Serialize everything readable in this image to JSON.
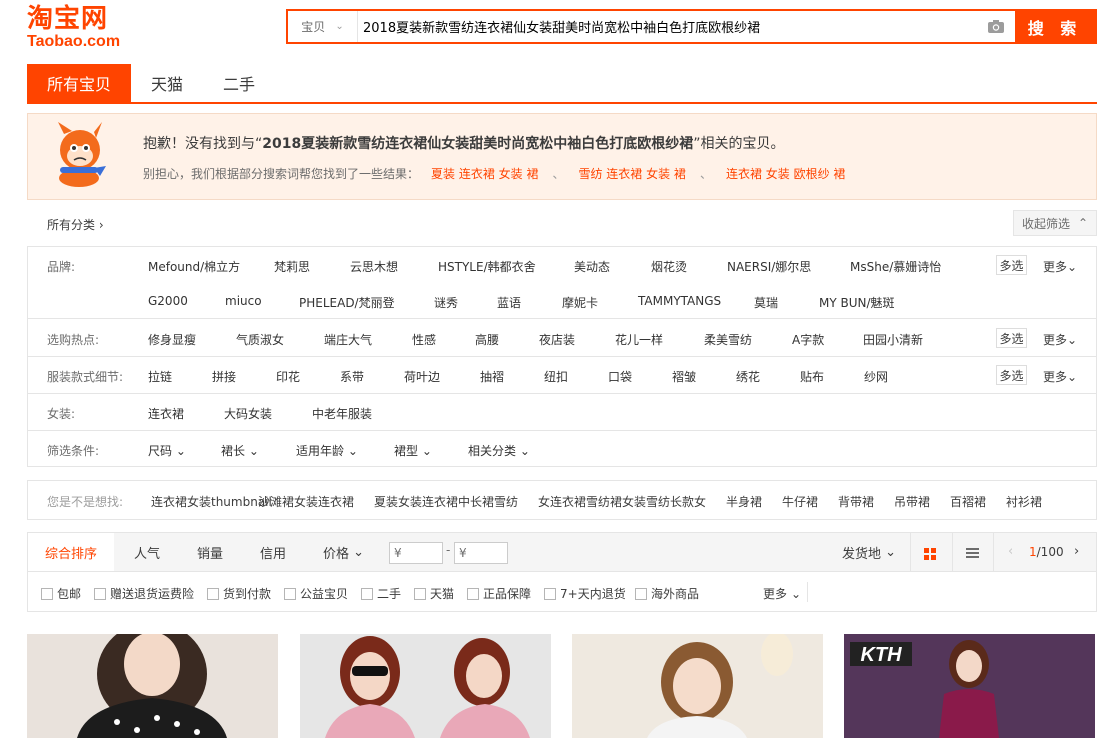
{
  "header": {
    "logo_cn": "淘宝网",
    "logo_en": "Taobao.com",
    "search_category": "宝贝",
    "search_query": "2018夏装新款雪纺连衣裙仙女装甜美时尚宽松中袖白色打底欧根纱裙",
    "search_button": "搜 索"
  },
  "tabs": [
    {
      "label": "所有宝贝",
      "active": true
    },
    {
      "label": "天猫",
      "active": false
    },
    {
      "label": "二手",
      "active": false
    }
  ],
  "notice": {
    "prefix": "抱歉！没有找到与“",
    "query": "2018夏装新款雪纺连衣裙仙女装甜美时尚宽松中袖白色打底欧根纱裙",
    "suffix": "”相关的宝贝。",
    "hint": "别担心，我们根据部分搜索词帮您找到了一些结果：",
    "suggestions": [
      "夏装 连衣裙 女装 裙",
      "雪纺 连衣裙 女装 裙",
      "连衣裙 女装 欧根纱 裙"
    ],
    "separator": "、"
  },
  "filter_header": {
    "all_categories": "所有分类",
    "collapse": "收起筛选"
  },
  "attributes": {
    "brand_label": "品牌:",
    "brands_row1": [
      "Mefound/棉立方",
      "梵莉思",
      "云思木想",
      "HSTYLE/韩都衣舍",
      "美动态",
      "烟花烫",
      "NAERSI/娜尔思",
      "MsShe/慕姗诗怡"
    ],
    "brands_row2": [
      "G2000",
      "miuco",
      "PHELEAD/梵丽登",
      "谜秀",
      "蓝语",
      "摩妮卡",
      "TAMMYTANGS",
      "莫瑞",
      "MY BUN/魅斑"
    ],
    "hot_label": "选购热点:",
    "hot": [
      "修身显瘦",
      "气质淑女",
      "端庄大气",
      "性感",
      "高腰",
      "夜店装",
      "花儿一样",
      "柔美雪纺",
      "A字款",
      "田园小清新"
    ],
    "detail_label": "服装款式细节:",
    "details": [
      "拉链",
      "拼接",
      "印花",
      "系带",
      "荷叶边",
      "抽褶",
      "纽扣",
      "口袋",
      "褶皱",
      "绣花",
      "贴布",
      "纱网"
    ],
    "women_label": "女装:",
    "women": [
      "连衣裙",
      "大码女装",
      "中老年服装"
    ],
    "cond_label": "筛选条件:",
    "conditions": [
      "尺码",
      "裙长",
      "适用年龄",
      "裙型",
      "相关分类"
    ],
    "multi_select": "多选",
    "more": "更多"
  },
  "maybe": {
    "label": "您是不是想找:",
    "keywords": [
      "连衣裙女装thumbnail",
      "沙滩裙女装连衣裙",
      "夏装女装连衣裙中长裙雪纺",
      "女连衣裙雪纺裙女装雪纺长款女",
      "半身裙",
      "牛仔裙",
      "背带裙",
      "吊带裙",
      "百褶裙",
      "衬衫裙"
    ]
  },
  "sortbar": {
    "items": [
      "综合排序",
      "人气",
      "销量",
      "信用",
      "价格"
    ],
    "price_from": "¥",
    "price_to": "¥",
    "dash": "-",
    "ship_from": "发货地",
    "page": "1",
    "total_pages": "/100"
  },
  "checks": [
    "包邮",
    "赠送退货运费险",
    "货到付款",
    "公益宝贝",
    "二手",
    "天猫",
    "正品保障",
    "7+天内退货",
    "海外商品"
  ],
  "checks_more": "更多",
  "products": [
    {
      "bg": "#e9e2dc"
    },
    {
      "bg": "#e6e6e6"
    },
    {
      "bg": "#efe9e0"
    },
    {
      "bg": "#54365a",
      "badge": "KTH"
    }
  ],
  "colors": {
    "accent": "#ff4400",
    "notice_bg": "#fff2e8"
  }
}
